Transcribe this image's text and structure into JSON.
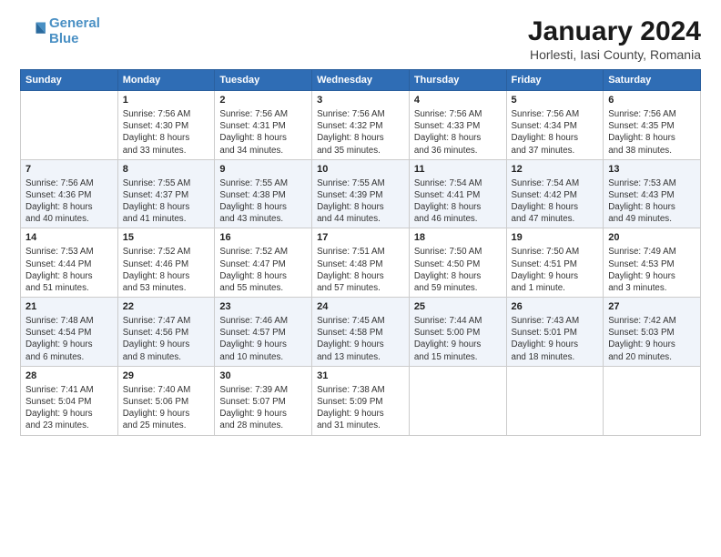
{
  "logo": {
    "line1": "General",
    "line2": "Blue"
  },
  "title": "January 2024",
  "subtitle": "Horlesti, Iasi County, Romania",
  "weekdays": [
    "Sunday",
    "Monday",
    "Tuesday",
    "Wednesday",
    "Thursday",
    "Friday",
    "Saturday"
  ],
  "weeks": [
    [
      {
        "day": "",
        "content": ""
      },
      {
        "day": "1",
        "content": "Sunrise: 7:56 AM\nSunset: 4:30 PM\nDaylight: 8 hours\nand 33 minutes."
      },
      {
        "day": "2",
        "content": "Sunrise: 7:56 AM\nSunset: 4:31 PM\nDaylight: 8 hours\nand 34 minutes."
      },
      {
        "day": "3",
        "content": "Sunrise: 7:56 AM\nSunset: 4:32 PM\nDaylight: 8 hours\nand 35 minutes."
      },
      {
        "day": "4",
        "content": "Sunrise: 7:56 AM\nSunset: 4:33 PM\nDaylight: 8 hours\nand 36 minutes."
      },
      {
        "day": "5",
        "content": "Sunrise: 7:56 AM\nSunset: 4:34 PM\nDaylight: 8 hours\nand 37 minutes."
      },
      {
        "day": "6",
        "content": "Sunrise: 7:56 AM\nSunset: 4:35 PM\nDaylight: 8 hours\nand 38 minutes."
      }
    ],
    [
      {
        "day": "7",
        "content": "Sunrise: 7:56 AM\nSunset: 4:36 PM\nDaylight: 8 hours\nand 40 minutes."
      },
      {
        "day": "8",
        "content": "Sunrise: 7:55 AM\nSunset: 4:37 PM\nDaylight: 8 hours\nand 41 minutes."
      },
      {
        "day": "9",
        "content": "Sunrise: 7:55 AM\nSunset: 4:38 PM\nDaylight: 8 hours\nand 43 minutes."
      },
      {
        "day": "10",
        "content": "Sunrise: 7:55 AM\nSunset: 4:39 PM\nDaylight: 8 hours\nand 44 minutes."
      },
      {
        "day": "11",
        "content": "Sunrise: 7:54 AM\nSunset: 4:41 PM\nDaylight: 8 hours\nand 46 minutes."
      },
      {
        "day": "12",
        "content": "Sunrise: 7:54 AM\nSunset: 4:42 PM\nDaylight: 8 hours\nand 47 minutes."
      },
      {
        "day": "13",
        "content": "Sunrise: 7:53 AM\nSunset: 4:43 PM\nDaylight: 8 hours\nand 49 minutes."
      }
    ],
    [
      {
        "day": "14",
        "content": "Sunrise: 7:53 AM\nSunset: 4:44 PM\nDaylight: 8 hours\nand 51 minutes."
      },
      {
        "day": "15",
        "content": "Sunrise: 7:52 AM\nSunset: 4:46 PM\nDaylight: 8 hours\nand 53 minutes."
      },
      {
        "day": "16",
        "content": "Sunrise: 7:52 AM\nSunset: 4:47 PM\nDaylight: 8 hours\nand 55 minutes."
      },
      {
        "day": "17",
        "content": "Sunrise: 7:51 AM\nSunset: 4:48 PM\nDaylight: 8 hours\nand 57 minutes."
      },
      {
        "day": "18",
        "content": "Sunrise: 7:50 AM\nSunset: 4:50 PM\nDaylight: 8 hours\nand 59 minutes."
      },
      {
        "day": "19",
        "content": "Sunrise: 7:50 AM\nSunset: 4:51 PM\nDaylight: 9 hours\nand 1 minute."
      },
      {
        "day": "20",
        "content": "Sunrise: 7:49 AM\nSunset: 4:53 PM\nDaylight: 9 hours\nand 3 minutes."
      }
    ],
    [
      {
        "day": "21",
        "content": "Sunrise: 7:48 AM\nSunset: 4:54 PM\nDaylight: 9 hours\nand 6 minutes."
      },
      {
        "day": "22",
        "content": "Sunrise: 7:47 AM\nSunset: 4:56 PM\nDaylight: 9 hours\nand 8 minutes."
      },
      {
        "day": "23",
        "content": "Sunrise: 7:46 AM\nSunset: 4:57 PM\nDaylight: 9 hours\nand 10 minutes."
      },
      {
        "day": "24",
        "content": "Sunrise: 7:45 AM\nSunset: 4:58 PM\nDaylight: 9 hours\nand 13 minutes."
      },
      {
        "day": "25",
        "content": "Sunrise: 7:44 AM\nSunset: 5:00 PM\nDaylight: 9 hours\nand 15 minutes."
      },
      {
        "day": "26",
        "content": "Sunrise: 7:43 AM\nSunset: 5:01 PM\nDaylight: 9 hours\nand 18 minutes."
      },
      {
        "day": "27",
        "content": "Sunrise: 7:42 AM\nSunset: 5:03 PM\nDaylight: 9 hours\nand 20 minutes."
      }
    ],
    [
      {
        "day": "28",
        "content": "Sunrise: 7:41 AM\nSunset: 5:04 PM\nDaylight: 9 hours\nand 23 minutes."
      },
      {
        "day": "29",
        "content": "Sunrise: 7:40 AM\nSunset: 5:06 PM\nDaylight: 9 hours\nand 25 minutes."
      },
      {
        "day": "30",
        "content": "Sunrise: 7:39 AM\nSunset: 5:07 PM\nDaylight: 9 hours\nand 28 minutes."
      },
      {
        "day": "31",
        "content": "Sunrise: 7:38 AM\nSunset: 5:09 PM\nDaylight: 9 hours\nand 31 minutes."
      },
      {
        "day": "",
        "content": ""
      },
      {
        "day": "",
        "content": ""
      },
      {
        "day": "",
        "content": ""
      }
    ]
  ]
}
